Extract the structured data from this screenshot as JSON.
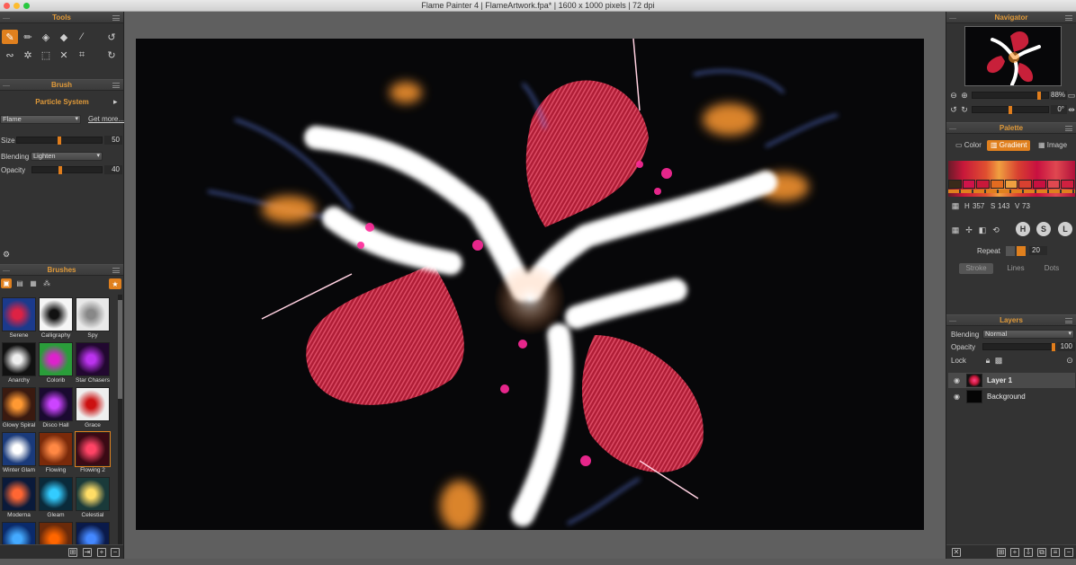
{
  "window": {
    "title": "Flame Painter 4 | FlameArtwork.fpa* | 1600 x 1000 pixels | 72 dpi"
  },
  "tools": {
    "header": "Tools",
    "row1": [
      "paint-brush-icon",
      "pencil-icon",
      "eraser-icon",
      "fill-bucket-icon",
      "eyedropper-icon",
      "undo-icon"
    ],
    "row2": [
      "lasso-icon",
      "transform-icon",
      "selection-icon",
      "fit-icon",
      "crop-icon",
      "redo-icon"
    ]
  },
  "brush": {
    "header": "Brush",
    "section": "Particle System",
    "preset": "Flame",
    "get_more": "Get more...",
    "size_label": "Size",
    "size_value": "50",
    "size_level": 0.5,
    "blending_label": "Blending",
    "blending_value": "Lighten",
    "opacity_label": "Opacity",
    "opacity_value": "40",
    "opacity_level": 0.4
  },
  "brushes": {
    "header": "Brushes",
    "items": [
      {
        "name": "Serene",
        "bg": "#1b3a8c",
        "fg": "#d24"
      },
      {
        "name": "Calligraphy",
        "bg": "#f5f5f5",
        "fg": "#111"
      },
      {
        "name": "Spy",
        "bg": "#e8e8e8",
        "fg": "#888"
      },
      {
        "name": "Anarchy",
        "bg": "#111",
        "fg": "#eee"
      },
      {
        "name": "Colorib",
        "bg": "#2a9d3a",
        "fg": "#d2c"
      },
      {
        "name": "Star Chasers",
        "bg": "#220830",
        "fg": "#b3e"
      },
      {
        "name": "Glowy Spiral",
        "bg": "#3a1a10",
        "fg": "#f93"
      },
      {
        "name": "Disco Hall",
        "bg": "#1a0a30",
        "fg": "#c4f"
      },
      {
        "name": "Grace",
        "bg": "#eee",
        "fg": "#c11"
      },
      {
        "name": "Winter Glam",
        "bg": "#1a3a7a",
        "fg": "#fff"
      },
      {
        "name": "Flowing",
        "bg": "#7a2a0a",
        "fg": "#f84"
      },
      {
        "name": "Flowing 2",
        "bg": "#3a0a14",
        "fg": "#f46"
      },
      {
        "name": "Moderna",
        "bg": "#0a1a3a",
        "fg": "#f63"
      },
      {
        "name": "Gleam",
        "bg": "#0a2a3a",
        "fg": "#3cf"
      },
      {
        "name": "Celestial",
        "bg": "#1a3a3a",
        "fg": "#fd6"
      },
      {
        "name": "",
        "bg": "#0a2a6a",
        "fg": "#4af"
      },
      {
        "name": "",
        "bg": "#6a2a0a",
        "fg": "#f60"
      },
      {
        "name": "",
        "bg": "#0a1a4a",
        "fg": "#48f"
      }
    ],
    "selected": "Flowing 2"
  },
  "navigator": {
    "header": "Navigator",
    "zoom_value": "88%",
    "zoom_level": 0.88,
    "rotation_value": "0°",
    "rotation_level": 0.5
  },
  "palette": {
    "header": "Palette",
    "tabs": [
      "Color",
      "Gradient",
      "Image"
    ],
    "active_tab": "Gradient",
    "h_label": "H",
    "h_value": "357",
    "s_label": "S",
    "s_value": "143",
    "v_label": "V",
    "v_value": "73",
    "circle_buttons": [
      "H",
      "S",
      "L"
    ],
    "repeat_label": "Repeat",
    "repeat_value": "20",
    "modes": [
      "Stroke",
      "Lines",
      "Dots"
    ],
    "active_mode": "Stroke",
    "swatches": [
      "#3a2a1a",
      "#d0134a",
      "#c8183a",
      "#e36b20",
      "#f0a040",
      "#d84030",
      "#c81040",
      "#e04850",
      "#d02040"
    ]
  },
  "layers": {
    "header": "Layers",
    "blending_label": "Blending",
    "blending_value": "Normal",
    "opacity_label": "Opacity",
    "opacity_value": "100",
    "opacity_level": 1.0,
    "lock_label": "Lock",
    "items": [
      {
        "name": "Layer 1",
        "selected": true
      },
      {
        "name": "Background",
        "selected": false
      }
    ]
  },
  "colors": {
    "accent": "#e0801e",
    "panel": "#333333",
    "canvas_bg": "#070709"
  }
}
